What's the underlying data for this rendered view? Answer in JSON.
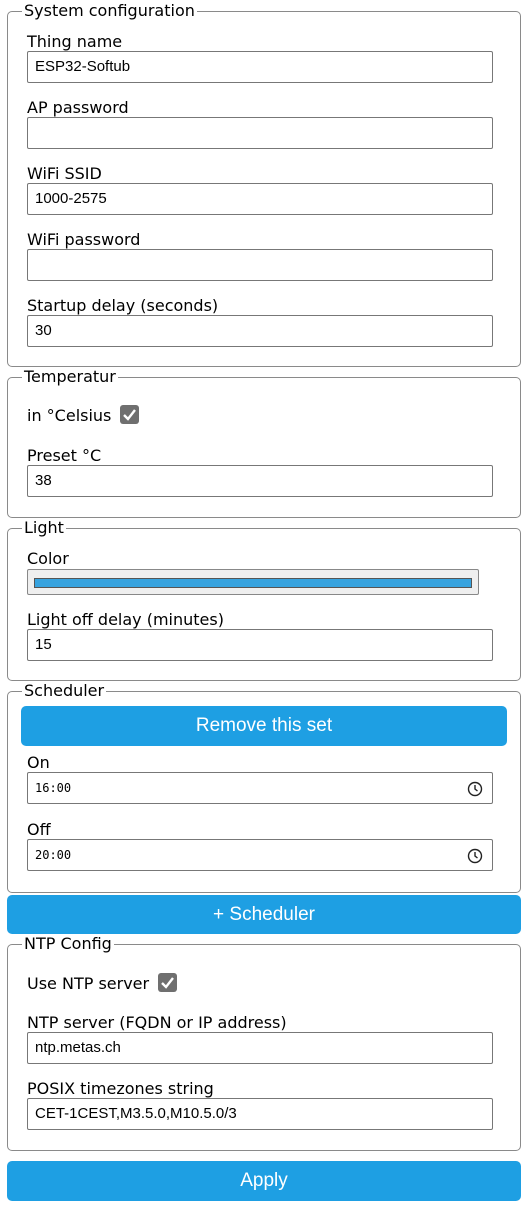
{
  "accent_color": "#1e9fe3",
  "light_color": "#37a3df",
  "system": {
    "legend": "System configuration",
    "thing_name_label": "Thing name",
    "thing_name_value": "ESP32-Softub",
    "ap_password_label": "AP password",
    "ap_password_value": "",
    "wifi_ssid_label": "WiFi SSID",
    "wifi_ssid_value": "1000-2575",
    "wifi_password_label": "WiFi password",
    "wifi_password_value": "",
    "startup_delay_label": "Startup delay (seconds)",
    "startup_delay_value": "30"
  },
  "temperature": {
    "legend": "Temperatur",
    "celsius_label": "in °Celsius",
    "celsius_checked": true,
    "preset_label": "Preset °C",
    "preset_value": "38"
  },
  "light": {
    "legend": "Light",
    "color_label": "Color",
    "off_delay_label": "Light off delay (minutes)",
    "off_delay_value": "15"
  },
  "scheduler": {
    "legend": "Scheduler",
    "remove_button": "Remove this set",
    "on_label": "On",
    "on_value": "16:00",
    "off_label": "Off",
    "off_value": "20:00",
    "add_button": "+ Scheduler"
  },
  "ntp": {
    "legend": "NTP Config",
    "use_ntp_label": "Use NTP server",
    "use_ntp_checked": true,
    "server_label": "NTP server (FQDN or IP address)",
    "server_value": "ntp.metas.ch",
    "tz_label": "POSIX timezones string",
    "tz_value": "CET-1CEST,M3.5.0,M10.5.0/3"
  },
  "apply_button": "Apply"
}
